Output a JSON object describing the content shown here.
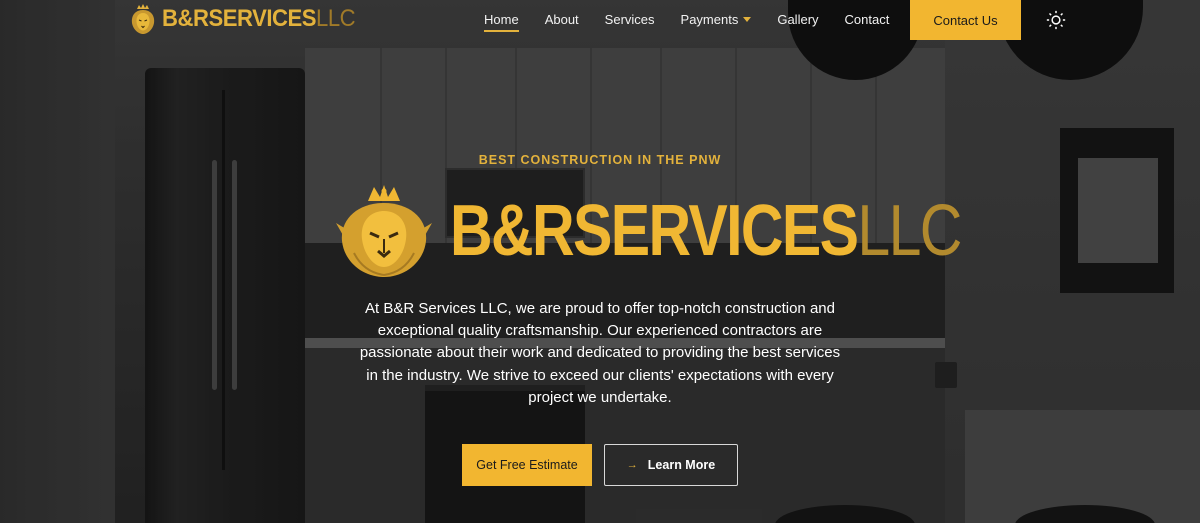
{
  "brand": {
    "name_main": "B&RSERVICES",
    "name_suffix": "LLC",
    "accent_color": "#f2b630",
    "logo_icon": "lion-crown-icon"
  },
  "nav": {
    "items": [
      {
        "label": "Home",
        "active": true
      },
      {
        "label": "About"
      },
      {
        "label": "Services"
      },
      {
        "label": "Payments",
        "has_dropdown": true
      },
      {
        "label": "Gallery"
      },
      {
        "label": "Contact"
      }
    ],
    "cta_label": "Contact Us",
    "theme_toggle_icon": "sun-icon"
  },
  "hero": {
    "eyebrow": "BEST CONSTRUCTION IN THE PNW",
    "description": "At B&R Services LLC, we are proud to offer top-notch construction and exceptional quality craftsmanship. Our experienced contractors are passionate about their work and dedicated to providing the best services in the industry. We strive to exceed our clients' expectations with every project we undertake.",
    "primary_button": "Get Free Estimate",
    "secondary_button": "Learn More",
    "secondary_button_icon": "arrow-right-icon"
  }
}
